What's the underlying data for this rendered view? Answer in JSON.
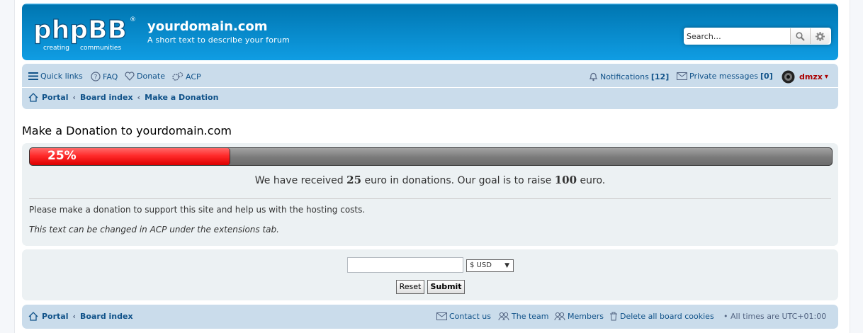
{
  "header": {
    "logo": {
      "main": "phpBB",
      "registered": "®",
      "tagline_a": "creating",
      "tagline_b": "communities"
    },
    "site_title": "yourdomain.com",
    "site_description": "A short text to describe your forum",
    "search": {
      "placeholder": "Search…",
      "value": "Search…"
    }
  },
  "navbar": {
    "quick_links": "Quick links",
    "faq": "FAQ",
    "donate": "Donate",
    "acp": "ACP",
    "notifications": "Notifications",
    "notifications_count": "[12]",
    "private_messages": "Private messages",
    "pm_count": "[0]",
    "username": "dmzx",
    "user_menu_arrow": "▾"
  },
  "breadcrumbs": [
    "Portal",
    "Board index",
    "Make a Donation"
  ],
  "separator": "‹",
  "page_title": "Make a Donation to yourdomain.com",
  "donation": {
    "progress_percent": 25,
    "progress_label": "25%",
    "text_a": "We have received",
    "received": "25",
    "text_b": "euro in donations. Our goal is to raise",
    "goal": "100",
    "text_c": "euro.",
    "message": "Please make a donation to support this site and help us with the hosting costs.",
    "note": "This text can be changed in ACP under the extensions tab."
  },
  "form": {
    "amount_value": "",
    "currency_selected": "$ USD",
    "reset_label": "Reset",
    "submit_label": "Submit"
  },
  "footer": {
    "breadcrumbs": [
      "Portal",
      "Board index"
    ],
    "contact": "Contact us",
    "team": "The team",
    "members": "Members",
    "delete_cookies": "Delete all board cookies",
    "bullet": "•",
    "timezone": "All times are UTC+01:00"
  },
  "colors": {
    "header_blue": "#12a3eb",
    "nav_bg": "#cadceb",
    "panel_bg": "#ecf1f3",
    "link": "#105289",
    "progress_red": "#ff2a2a",
    "username_red": "#aa0000"
  }
}
